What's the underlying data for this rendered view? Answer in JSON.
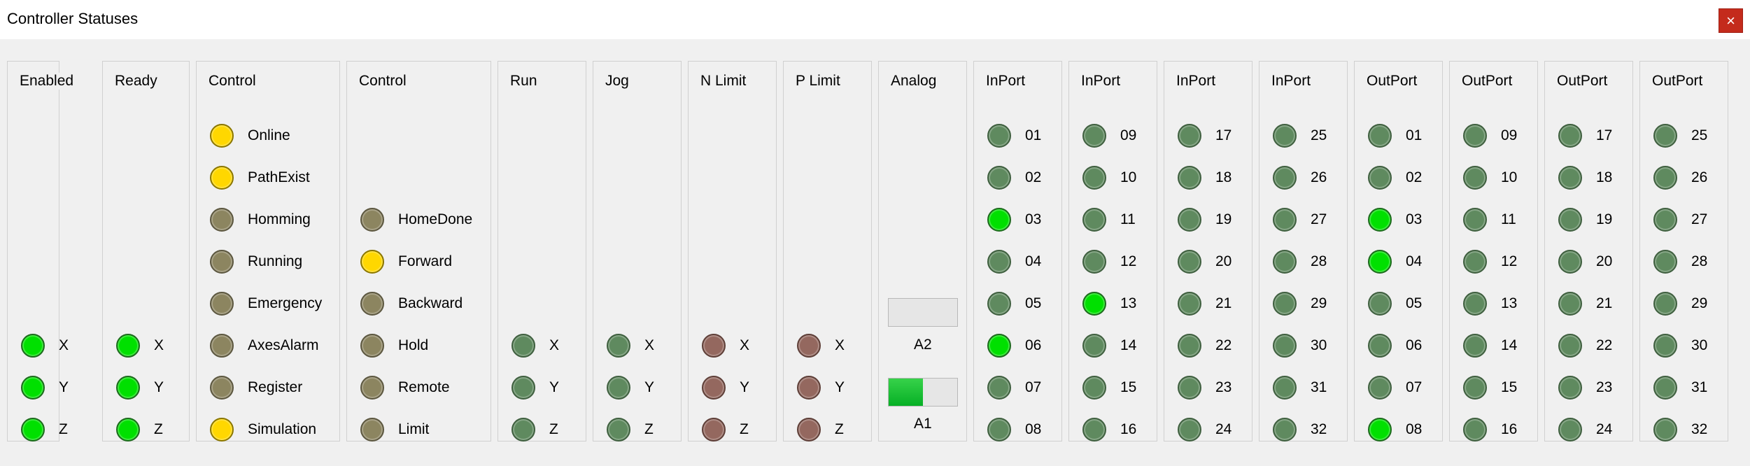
{
  "window": {
    "title": "Controller Statuses",
    "close_glyph": "×"
  },
  "colors": {
    "green": "#00e000",
    "dim_green": "#5f8a5f",
    "yellow": "#ffd700",
    "dim_yellow": "#8c8560",
    "dim_red": "#94685f"
  },
  "groups": {
    "enabled": {
      "label": "Enabled",
      "items": [
        {
          "text": "X",
          "state": "green"
        },
        {
          "text": "Y",
          "state": "green"
        },
        {
          "text": "Z",
          "state": "green"
        }
      ]
    },
    "ready": {
      "label": "Ready",
      "items": [
        {
          "text": "X",
          "state": "green"
        },
        {
          "text": "Y",
          "state": "green"
        },
        {
          "text": "Z",
          "state": "green"
        }
      ]
    },
    "control1": {
      "label": "Control",
      "items": [
        {
          "text": "Online",
          "state": "yellow"
        },
        {
          "text": "PathExist",
          "state": "yellow"
        },
        {
          "text": "Homming",
          "state": "dim_yellow"
        },
        {
          "text": "Running",
          "state": "dim_yellow"
        },
        {
          "text": "Emergency",
          "state": "dim_yellow"
        },
        {
          "text": "AxesAlarm",
          "state": "dim_yellow"
        },
        {
          "text": "Register",
          "state": "dim_yellow"
        },
        {
          "text": "Simulation",
          "state": "yellow"
        }
      ]
    },
    "control2": {
      "label": "Control",
      "items": [
        {
          "text": "HomeDone",
          "state": "dim_yellow"
        },
        {
          "text": "Forward",
          "state": "yellow"
        },
        {
          "text": "Backward",
          "state": "dim_yellow"
        },
        {
          "text": "Hold",
          "state": "dim_yellow"
        },
        {
          "text": "Remote",
          "state": "dim_yellow"
        },
        {
          "text": "Limit",
          "state": "dim_yellow"
        }
      ]
    },
    "run": {
      "label": "Run",
      "items": [
        {
          "text": "X",
          "state": "dim_green"
        },
        {
          "text": "Y",
          "state": "dim_green"
        },
        {
          "text": "Z",
          "state": "dim_green"
        }
      ]
    },
    "jog": {
      "label": "Jog",
      "items": [
        {
          "text": "X",
          "state": "dim_green"
        },
        {
          "text": "Y",
          "state": "dim_green"
        },
        {
          "text": "Z",
          "state": "dim_green"
        }
      ]
    },
    "nlimit": {
      "label": "N Limit",
      "items": [
        {
          "text": "X",
          "state": "dim_red"
        },
        {
          "text": "Y",
          "state": "dim_red"
        },
        {
          "text": "Z",
          "state": "dim_red"
        }
      ]
    },
    "plimit": {
      "label": "P Limit",
      "items": [
        {
          "text": "X",
          "state": "dim_red"
        },
        {
          "text": "Y",
          "state": "dim_red"
        },
        {
          "text": "Z",
          "state": "dim_red"
        }
      ]
    },
    "analog": {
      "label": "Analog",
      "bars": [
        {
          "label": "A2",
          "fraction": 0.0
        },
        {
          "label": "A1",
          "fraction": 0.5
        }
      ]
    },
    "inport1": {
      "label": "InPort",
      "items": [
        {
          "text": "01",
          "state": "dim_green"
        },
        {
          "text": "02",
          "state": "dim_green"
        },
        {
          "text": "03",
          "state": "green"
        },
        {
          "text": "04",
          "state": "dim_green"
        },
        {
          "text": "05",
          "state": "dim_green"
        },
        {
          "text": "06",
          "state": "green"
        },
        {
          "text": "07",
          "state": "dim_green"
        },
        {
          "text": "08",
          "state": "dim_green"
        }
      ]
    },
    "inport2": {
      "label": "InPort",
      "items": [
        {
          "text": "09",
          "state": "dim_green"
        },
        {
          "text": "10",
          "state": "dim_green"
        },
        {
          "text": "11",
          "state": "dim_green"
        },
        {
          "text": "12",
          "state": "dim_green"
        },
        {
          "text": "13",
          "state": "green"
        },
        {
          "text": "14",
          "state": "dim_green"
        },
        {
          "text": "15",
          "state": "dim_green"
        },
        {
          "text": "16",
          "state": "dim_green"
        }
      ]
    },
    "inport3": {
      "label": "InPort",
      "items": [
        {
          "text": "17",
          "state": "dim_green"
        },
        {
          "text": "18",
          "state": "dim_green"
        },
        {
          "text": "19",
          "state": "dim_green"
        },
        {
          "text": "20",
          "state": "dim_green"
        },
        {
          "text": "21",
          "state": "dim_green"
        },
        {
          "text": "22",
          "state": "dim_green"
        },
        {
          "text": "23",
          "state": "dim_green"
        },
        {
          "text": "24",
          "state": "dim_green"
        }
      ]
    },
    "inport4": {
      "label": "InPort",
      "items": [
        {
          "text": "25",
          "state": "dim_green"
        },
        {
          "text": "26",
          "state": "dim_green"
        },
        {
          "text": "27",
          "state": "dim_green"
        },
        {
          "text": "28",
          "state": "dim_green"
        },
        {
          "text": "29",
          "state": "dim_green"
        },
        {
          "text": "30",
          "state": "dim_green"
        },
        {
          "text": "31",
          "state": "dim_green"
        },
        {
          "text": "32",
          "state": "dim_green"
        }
      ]
    },
    "outport1": {
      "label": "OutPort",
      "items": [
        {
          "text": "01",
          "state": "dim_green"
        },
        {
          "text": "02",
          "state": "dim_green"
        },
        {
          "text": "03",
          "state": "green"
        },
        {
          "text": "04",
          "state": "green"
        },
        {
          "text": "05",
          "state": "dim_green"
        },
        {
          "text": "06",
          "state": "dim_green"
        },
        {
          "text": "07",
          "state": "dim_green"
        },
        {
          "text": "08",
          "state": "green"
        }
      ]
    },
    "outport2": {
      "label": "OutPort",
      "items": [
        {
          "text": "09",
          "state": "dim_green"
        },
        {
          "text": "10",
          "state": "dim_green"
        },
        {
          "text": "11",
          "state": "dim_green"
        },
        {
          "text": "12",
          "state": "dim_green"
        },
        {
          "text": "13",
          "state": "dim_green"
        },
        {
          "text": "14",
          "state": "dim_green"
        },
        {
          "text": "15",
          "state": "dim_green"
        },
        {
          "text": "16",
          "state": "dim_green"
        }
      ]
    },
    "outport3": {
      "label": "OutPort",
      "items": [
        {
          "text": "17",
          "state": "dim_green"
        },
        {
          "text": "18",
          "state": "dim_green"
        },
        {
          "text": "19",
          "state": "dim_green"
        },
        {
          "text": "20",
          "state": "dim_green"
        },
        {
          "text": "21",
          "state": "dim_green"
        },
        {
          "text": "22",
          "state": "dim_green"
        },
        {
          "text": "23",
          "state": "dim_green"
        },
        {
          "text": "24",
          "state": "dim_green"
        }
      ]
    },
    "outport4": {
      "label": "OutPort",
      "items": [
        {
          "text": "25",
          "state": "dim_green"
        },
        {
          "text": "26",
          "state": "dim_green"
        },
        {
          "text": "27",
          "state": "dim_green"
        },
        {
          "text": "28",
          "state": "dim_green"
        },
        {
          "text": "29",
          "state": "dim_green"
        },
        {
          "text": "30",
          "state": "dim_green"
        },
        {
          "text": "31",
          "state": "dim_green"
        },
        {
          "text": "32",
          "state": "dim_green"
        }
      ]
    }
  }
}
